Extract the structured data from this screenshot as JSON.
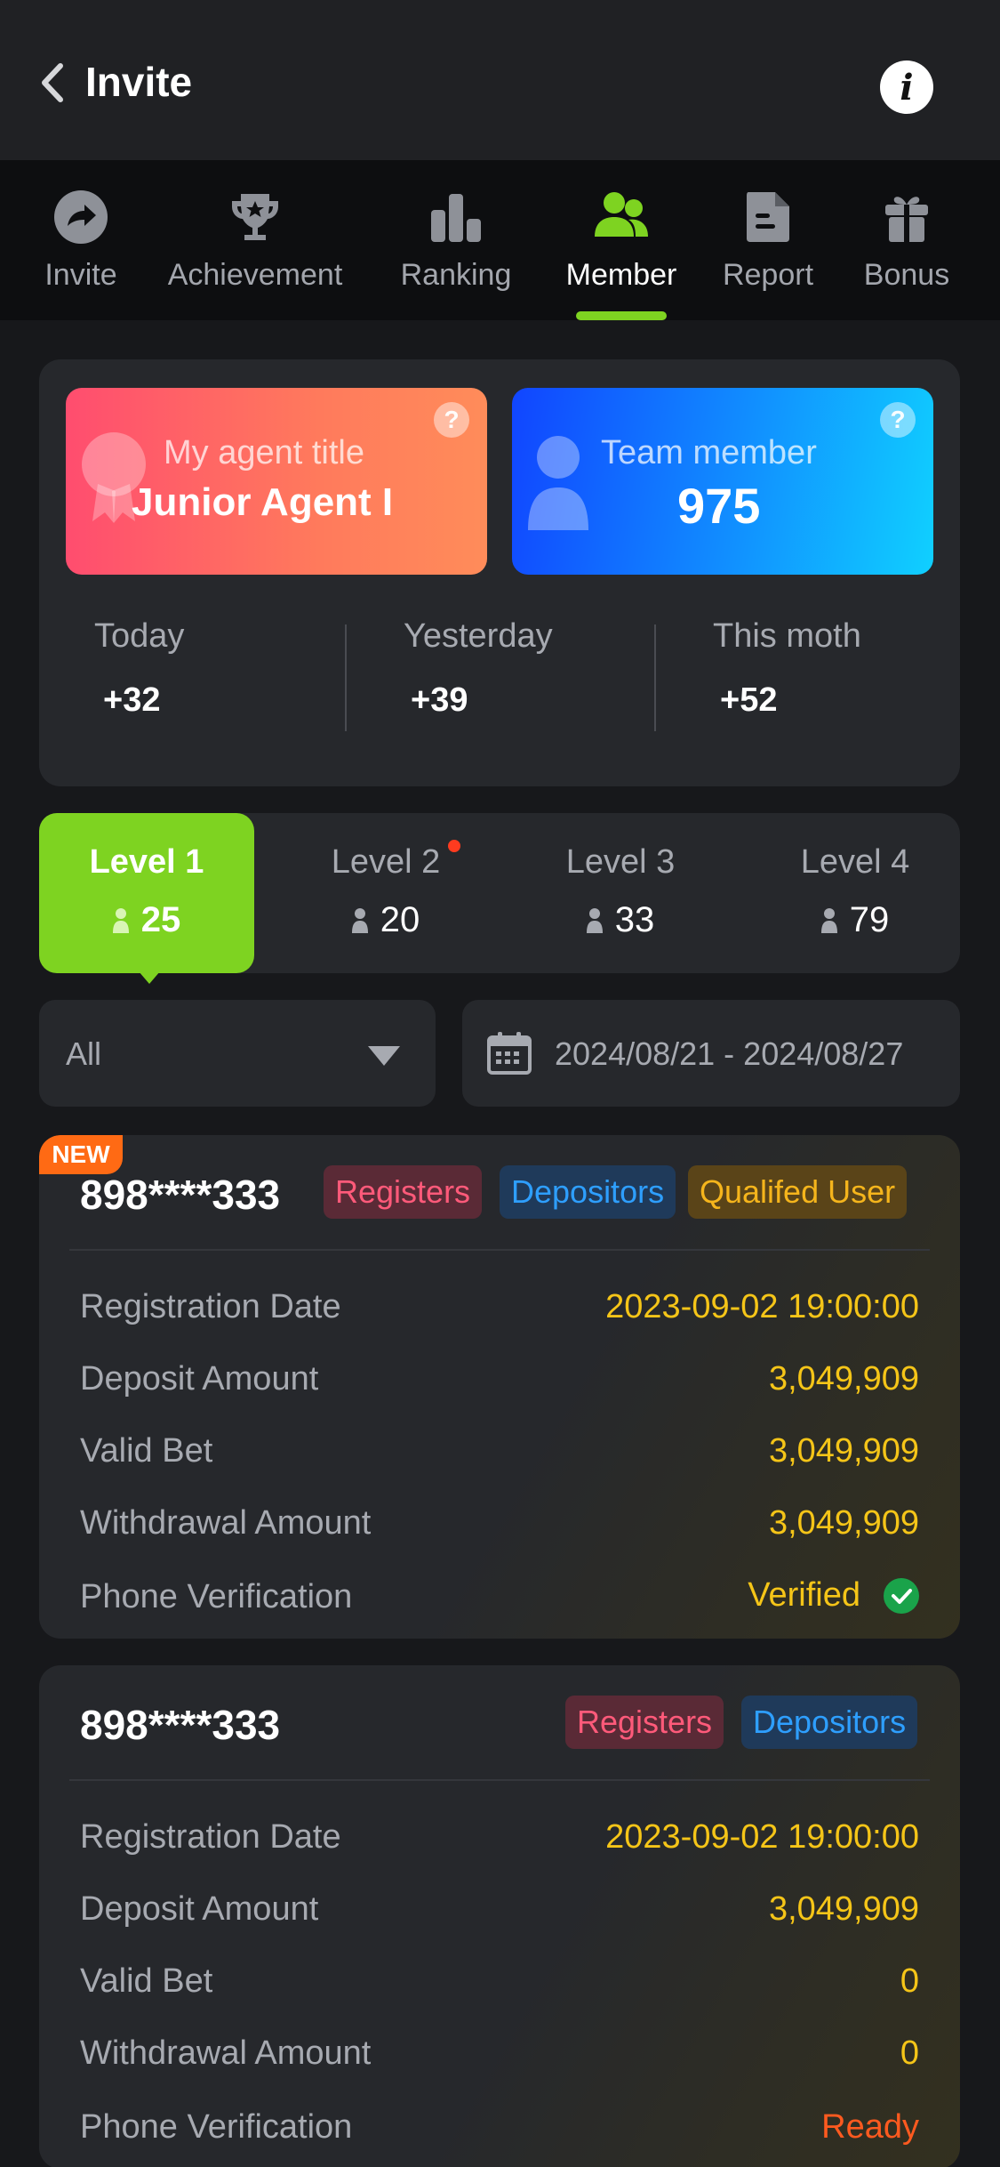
{
  "header": {
    "title": "Invite",
    "info_glyph": "i"
  },
  "tabs": [
    {
      "label": "Invite",
      "icon": "share-arrow-icon",
      "active": false
    },
    {
      "label": "Achievement",
      "icon": "trophy-icon",
      "active": false
    },
    {
      "label": "Ranking",
      "icon": "bar-chart-icon",
      "active": false
    },
    {
      "label": "Member",
      "icon": "group-icon",
      "active": true
    },
    {
      "label": "Report",
      "icon": "document-icon",
      "active": false
    },
    {
      "label": "Bonus",
      "icon": "gift-icon",
      "active": false
    }
  ],
  "summary": {
    "agent": {
      "label": "My agent title",
      "value": "Junior Agent I",
      "help": "?"
    },
    "team": {
      "label": "Team member",
      "value": "975",
      "help": "?"
    },
    "stats": [
      {
        "label": "Today",
        "value": "+32"
      },
      {
        "label": "Yesterday",
        "value": "+39"
      },
      {
        "label": "This moth",
        "value": "+52"
      }
    ]
  },
  "levels": [
    {
      "name": "Level 1",
      "count": "25",
      "active": true,
      "dot": false
    },
    {
      "name": "Level 2",
      "count": "20",
      "active": false,
      "dot": true
    },
    {
      "name": "Level 3",
      "count": "33",
      "active": false,
      "dot": false
    },
    {
      "name": "Level 4",
      "count": "79",
      "active": false,
      "dot": false
    }
  ],
  "filters": {
    "status_selected": "All",
    "date_range": "2024/08/21 - 2024/08/27"
  },
  "members": [
    {
      "new_badge": "NEW",
      "id": "898****333",
      "tags": [
        "Registers",
        "Depositors",
        "Qualifed User"
      ],
      "rows": [
        {
          "label": "Registration Date",
          "value": "2023-09-02 19:00:00"
        },
        {
          "label": "Deposit Amount",
          "value": "3,049,909"
        },
        {
          "label": "Valid Bet",
          "value": "3,049,909"
        },
        {
          "label": "Withdrawal Amount",
          "value": "3,049,909"
        },
        {
          "label": "Phone Verification",
          "value": "Verified"
        }
      ]
    },
    {
      "id": "898****333",
      "tags": [
        "Registers",
        "Depositors"
      ],
      "rows": [
        {
          "label": "Registration Date",
          "value": "2023-09-02 19:00:00"
        },
        {
          "label": "Deposit Amount",
          "value": "3,049,909"
        },
        {
          "label": "Valid Bet",
          "value": "0"
        },
        {
          "label": "Withdrawal Amount",
          "value": "0"
        },
        {
          "label": "Phone Verification",
          "value": "Ready"
        }
      ]
    }
  ],
  "colors": {
    "accent_green": "#7ed321",
    "value_yellow": "#f5c518",
    "ready_orange": "#ff5a1f",
    "new_badge": "#ff6a14"
  }
}
